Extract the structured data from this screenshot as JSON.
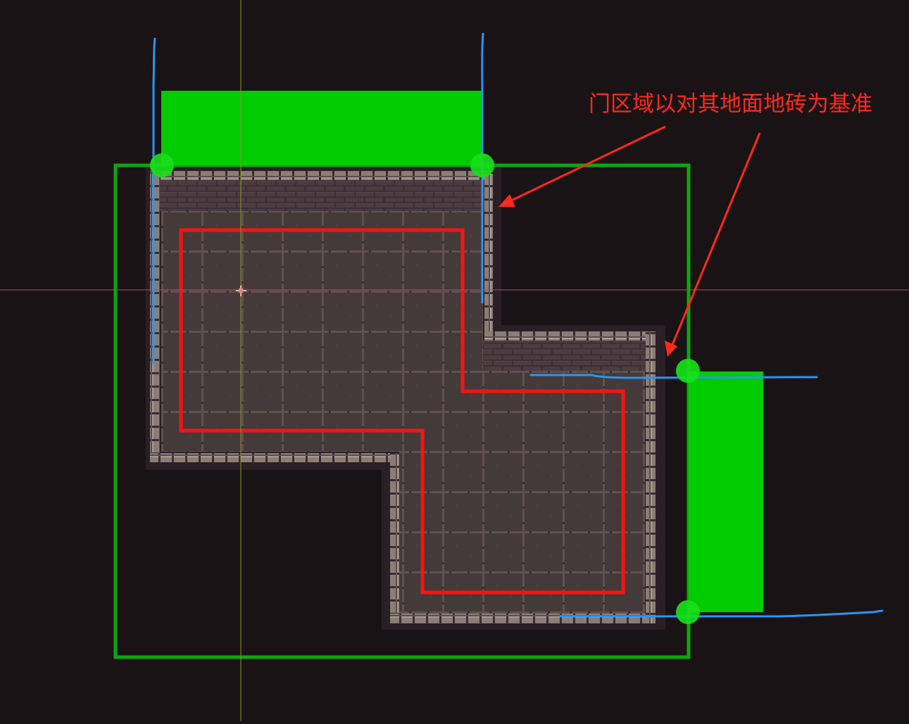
{
  "scene": {
    "background": "#1a1316",
    "annotation": {
      "text": "门区域以对其地面地砖为基准",
      "color": "#ff2a1a"
    },
    "colors": {
      "outer_bounds": "#0fa50f",
      "door_region": "#00cc00",
      "door_anchor": "#18e018",
      "guide_line": "#2b95ee",
      "floor_outline": "#ff1010",
      "arrow": "#ff2a1a",
      "floor_tile": "#453a3a",
      "tile_grout": "#62524f",
      "wall_top": "#8a7d77",
      "wall_brick": "#3d3036",
      "crosshair_vertical": "#8a9a30",
      "crosshair_horizontal": "#a0506e",
      "cursor": "#f0a8a8"
    },
    "icons": {
      "cursor": "crosshair-cursor-icon",
      "door_anchor": "anchor-dot-icon"
    }
  }
}
